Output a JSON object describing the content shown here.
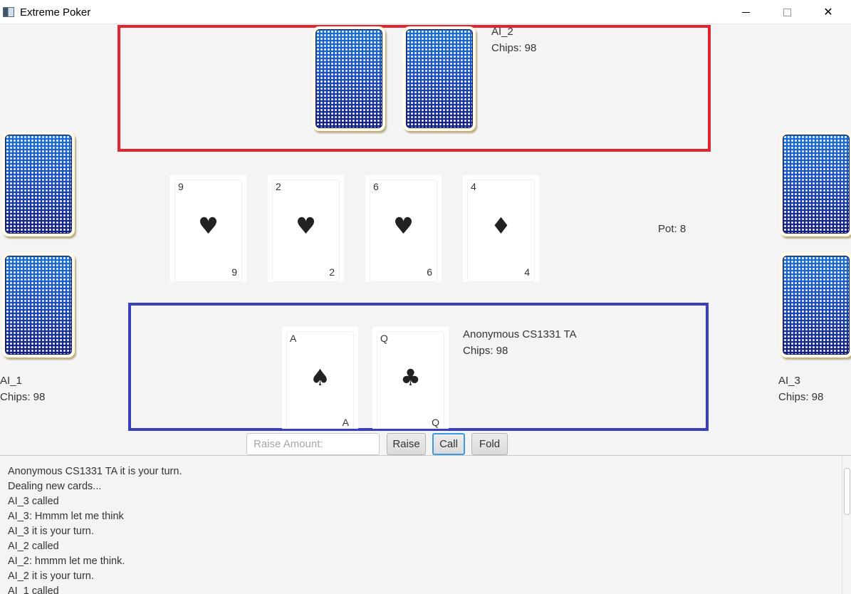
{
  "window": {
    "title": "Extreme Poker",
    "controls": {
      "minimize": "",
      "maximize": "",
      "close": "✕"
    }
  },
  "ai2": {
    "name": "AI_2",
    "chips": "Chips: 98"
  },
  "ai1": {
    "name": "AI_1",
    "chips": "Chips: 98"
  },
  "ai3": {
    "name": "AI_3",
    "chips": "Chips: 98"
  },
  "user": {
    "name": "Anonymous CS1331 TA",
    "chips": "Chips: 98",
    "cards": [
      {
        "rank": "A",
        "suit": "♠",
        "suit_name": "spade-icon"
      },
      {
        "rank": "Q",
        "suit": "♣",
        "suit_name": "club-icon"
      }
    ]
  },
  "community": [
    {
      "rank": "9",
      "suit": "♥",
      "suit_name": "heart-icon"
    },
    {
      "rank": "2",
      "suit": "♥",
      "suit_name": "heart-icon"
    },
    {
      "rank": "6",
      "suit": "♥",
      "suit_name": "heart-icon"
    },
    {
      "rank": "4",
      "suit": "♦",
      "suit_name": "diamond-icon"
    }
  ],
  "pot": "Pot: 8",
  "controls": {
    "raise_placeholder": "Raise Amount:",
    "raise_value": "",
    "raise_label": "Raise",
    "call_label": "Call",
    "fold_label": "Fold"
  },
  "log": [
    "Anonymous CS1331 TA it is your turn.",
    "Dealing new cards...",
    "AI_3 called",
    "AI_3: Hmmm let me think",
    "AI_3 it is your turn.",
    "AI_2 called",
    "AI_2: hmmm let me think.",
    "AI_2 it is your turn.",
    "AI_1 called"
  ],
  "colors": {
    "ai_box": "#e3232f",
    "user_box": "#3a3fbd",
    "focus": "#3b9ae0"
  }
}
